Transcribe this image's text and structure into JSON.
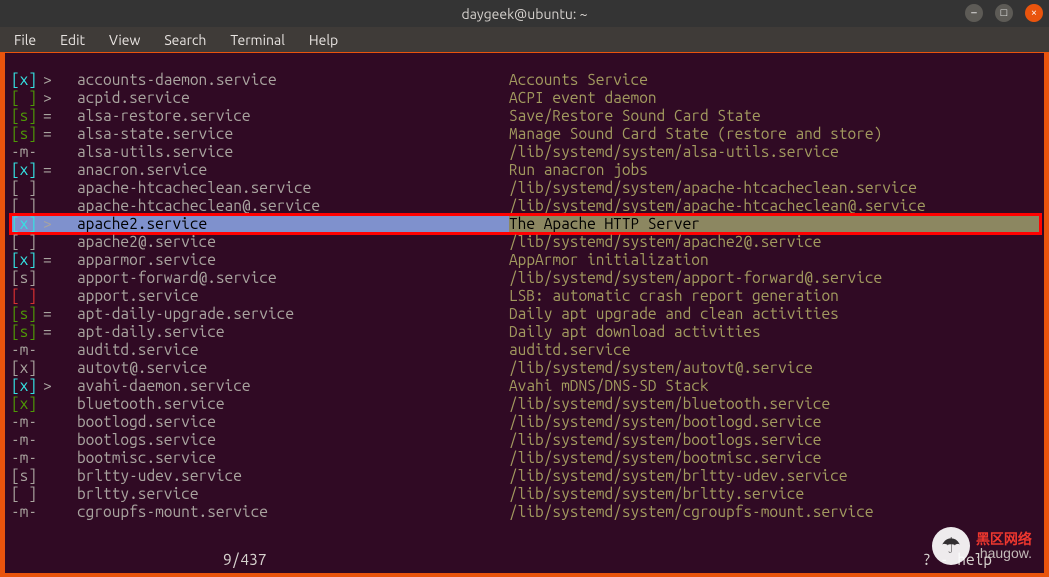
{
  "window": {
    "title": "daygeek@ubuntu: ~",
    "btn_min": "–",
    "btn_max": "□",
    "btn_close": "×"
  },
  "menu": {
    "file": "File",
    "edit": "Edit",
    "view": "View",
    "search": "Search",
    "terminal": "Terminal",
    "help": "Help"
  },
  "rows": [
    {
      "state": "[x]",
      "state_cls": "c-cyan",
      "link": ">",
      "name": "accounts-daemon.service",
      "desc": "Accounts Service",
      "desc_cls": "c-olive"
    },
    {
      "state": "[ ]",
      "state_cls": "c-green",
      "link": ">",
      "name": "acpid.service",
      "desc": "ACPI event daemon",
      "desc_cls": "c-olive"
    },
    {
      "state": "[s]",
      "state_cls": "c-green",
      "link": "=",
      "name": "alsa-restore.service",
      "desc": "Save/Restore Sound Card State",
      "desc_cls": "c-olive"
    },
    {
      "state": "[s]",
      "state_cls": "c-green",
      "link": "=",
      "name": "alsa-state.service",
      "desc": "Manage Sound Card State (restore and store)",
      "desc_cls": "c-olive"
    },
    {
      "state": "-m-",
      "state_cls": "c-grey",
      "link": "",
      "name": "alsa-utils.service",
      "desc": "/lib/systemd/system/alsa-utils.service",
      "desc_cls": "c-olive"
    },
    {
      "state": "[x]",
      "state_cls": "c-cyan",
      "link": "=",
      "name": "anacron.service",
      "desc": "Run anacron jobs",
      "desc_cls": "c-olive"
    },
    {
      "state": "[ ]",
      "state_cls": "c-grey",
      "link": "",
      "name": "apache-htcacheclean.service",
      "desc": "/lib/systemd/system/apache-htcacheclean.service",
      "desc_cls": "c-olive"
    },
    {
      "state": "[ ]",
      "state_cls": "c-grey",
      "link": "",
      "name": "apache-htcacheclean@.service",
      "desc": "/lib/systemd/system/apache-htcacheclean@.service",
      "desc_cls": "c-olive"
    },
    {
      "state": "[x]",
      "state_cls": "c-cyan",
      "link": ">",
      "name": "apache2.service",
      "desc": "The Apache HTTP Server",
      "desc_cls": "c-black",
      "hilite": true
    },
    {
      "state": "[ ]",
      "state_cls": "c-grey",
      "link": "",
      "name": "apache2@.service",
      "desc": "/lib/systemd/system/apache2@.service",
      "desc_cls": "c-olive"
    },
    {
      "state": "[x]",
      "state_cls": "c-cyan",
      "link": "=",
      "name": "apparmor.service",
      "desc": "AppArmor initialization",
      "desc_cls": "c-olive"
    },
    {
      "state": "[s]",
      "state_cls": "c-grey",
      "link": "",
      "name": "apport-forward@.service",
      "desc": "/lib/systemd/system/apport-forward@.service",
      "desc_cls": "c-olive"
    },
    {
      "state": "[ ]",
      "state_cls": "c-red",
      "link": "",
      "name": "apport.service",
      "desc": "LSB: automatic crash report generation",
      "desc_cls": "c-olive"
    },
    {
      "state": "[s]",
      "state_cls": "c-green",
      "link": "=",
      "name": "apt-daily-upgrade.service",
      "desc": "Daily apt upgrade and clean activities",
      "desc_cls": "c-olive"
    },
    {
      "state": "[s]",
      "state_cls": "c-green",
      "link": "=",
      "name": "apt-daily.service",
      "desc": "Daily apt download activities",
      "desc_cls": "c-olive"
    },
    {
      "state": "-m-",
      "state_cls": "c-grey",
      "link": "",
      "name": "auditd.service",
      "desc": "auditd.service",
      "desc_cls": "c-olive"
    },
    {
      "state": "[x]",
      "state_cls": "c-grey",
      "link": "",
      "name": "autovt@.service",
      "desc": "/lib/systemd/system/autovt@.service",
      "desc_cls": "c-olive"
    },
    {
      "state": "[x]",
      "state_cls": "c-cyan",
      "link": ">",
      "name": "avahi-daemon.service",
      "desc": "Avahi mDNS/DNS-SD Stack",
      "desc_cls": "c-olive"
    },
    {
      "state": "[x]",
      "state_cls": "c-green",
      "link": "",
      "name": "bluetooth.service",
      "desc": "/lib/systemd/system/bluetooth.service",
      "desc_cls": "c-olive"
    },
    {
      "state": "-m-",
      "state_cls": "c-grey",
      "link": "",
      "name": "bootlogd.service",
      "desc": "/lib/systemd/system/bootlogd.service",
      "desc_cls": "c-olive"
    },
    {
      "state": "-m-",
      "state_cls": "c-grey",
      "link": "",
      "name": "bootlogs.service",
      "desc": "/lib/systemd/system/bootlogs.service",
      "desc_cls": "c-olive"
    },
    {
      "state": "-m-",
      "state_cls": "c-grey",
      "link": "",
      "name": "bootmisc.service",
      "desc": "/lib/systemd/system/bootmisc.service",
      "desc_cls": "c-olive"
    },
    {
      "state": "[s]",
      "state_cls": "c-grey",
      "link": "",
      "name": "brltty-udev.service",
      "desc": "/lib/systemd/system/brltty-udev.service",
      "desc_cls": "c-olive"
    },
    {
      "state": "[ ]",
      "state_cls": "c-grey",
      "link": "",
      "name": "brltty.service",
      "desc": "/lib/systemd/system/brltty.service",
      "desc_cls": "c-olive"
    },
    {
      "state": "-m-",
      "state_cls": "c-grey",
      "link": "",
      "name": "cgroupfs-mount.service",
      "desc": "/lib/systemd/system/cgroupfs-mount.service",
      "desc_cls": "c-olive"
    }
  ],
  "status": {
    "pos": "9/437",
    "help": "? - help"
  },
  "watermark": {
    "icon": "☂",
    "line1": "黑区网络",
    "line2": "  .haugow."
  }
}
